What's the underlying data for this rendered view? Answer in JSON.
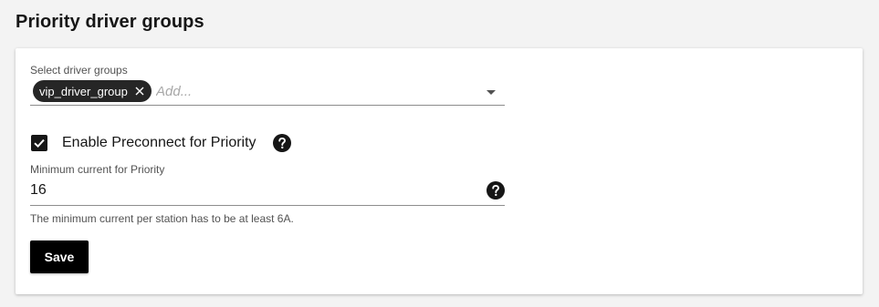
{
  "page": {
    "title": "Priority driver groups"
  },
  "driver_groups": {
    "label": "Select driver groups",
    "selected_tags": [
      "vip_driver_group"
    ],
    "placeholder": "Add...",
    "value": ""
  },
  "preconnect": {
    "label": "Enable Preconnect for Priority",
    "checked": true
  },
  "minimum_current": {
    "label": "Minimum current for Priority",
    "value": "16",
    "helper_text": "The minimum current per station has to be at least 6A."
  },
  "actions": {
    "save_label": "Save"
  },
  "colors": {
    "primary": "#000000",
    "tag_bg": "#262626",
    "background": "#f3f3f3",
    "card": "#ffffff"
  },
  "icons": {
    "tag_remove": "close-icon",
    "dropdown": "chevron-down-icon",
    "checkbox": "checkmark-icon",
    "help": "help-icon"
  }
}
